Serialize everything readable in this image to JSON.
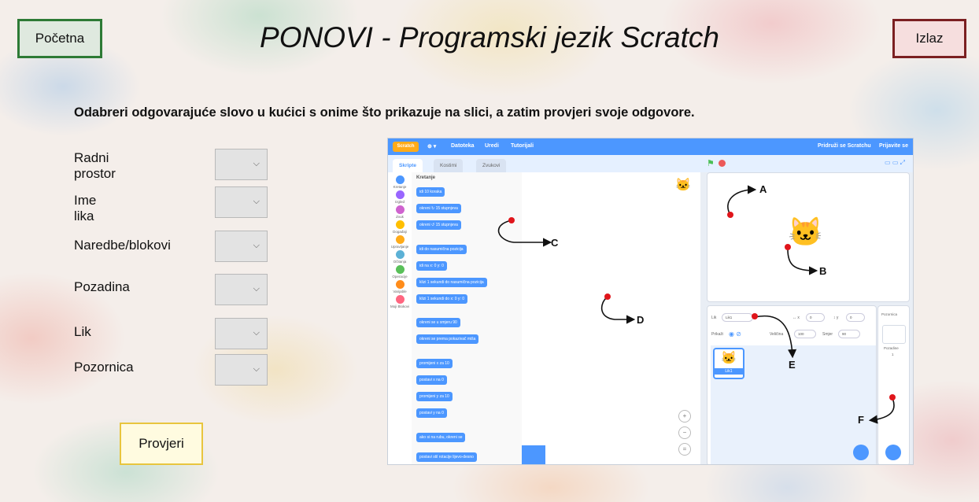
{
  "header": {
    "home_label": "Početna",
    "title": "PONOVI - Programski jezik Scratch",
    "exit_label": "Izlaz"
  },
  "instruction": "Odabreri odgovarajuće slovo u kućici s onime što prikazuje na slici, a zatim provjeri svoje odgovore.",
  "rows": [
    {
      "label": "Radni prostor",
      "value": ""
    },
    {
      "label": "Ime lika",
      "value": ""
    },
    {
      "label": "Naredbe/blokovi",
      "value": ""
    },
    {
      "label": "Pozadina",
      "value": ""
    },
    {
      "label": "Lik",
      "value": ""
    },
    {
      "label": "Pozornica",
      "value": ""
    }
  ],
  "check_label": "Provjeri",
  "scratch": {
    "logo": "Scratch",
    "menu": [
      "Datoteka",
      "Uredi",
      "Tutorijali"
    ],
    "menu_right": [
      "Pridruži se Scratchu",
      "Prijavite se"
    ],
    "tabs": [
      "Skripte",
      "Kostimi",
      "Zvukovi"
    ],
    "palette_title": "Kretanje",
    "categories": [
      {
        "name": "Kretanje",
        "color": "#4c97ff"
      },
      {
        "name": "Izgled",
        "color": "#9966ff"
      },
      {
        "name": "Zvuk",
        "color": "#cf63cf"
      },
      {
        "name": "Događaji",
        "color": "#ffbf00"
      },
      {
        "name": "Upravljanje",
        "color": "#ffab19"
      },
      {
        "name": "Očitanja",
        "color": "#5cb1d6"
      },
      {
        "name": "Operacije",
        "color": "#59c059"
      },
      {
        "name": "Varijable",
        "color": "#ff8c1a"
      },
      {
        "name": "Moji Blokovi",
        "color": "#ff6680"
      }
    ],
    "blocks": [
      "idi 10 koraka",
      "okreni ↻ 15 stupnjeva",
      "okreni ↺ 15 stupnjeva",
      "idi do nasumična pozicija",
      "idi na x: 0 y: 0",
      "klizi 1 sekundi do nasumična pozicija",
      "klizi 1 sekundi do x: 0 y: 0",
      "okreni se u smjeru 90",
      "okreni se prema pokazivač miša",
      "promijeni x za 10",
      "postavi x na 0",
      "promijeni y za 10",
      "postavi y na 0",
      "ako si na rubu, okreni se",
      "postavi stil rotacije lijevo-desno"
    ],
    "sprite": {
      "label": "Lik",
      "name": "Lik1",
      "x": "0",
      "y": "0",
      "show_label": "Prikaži",
      "size_label": "Veličina",
      "size": "100",
      "direction_label": "Smjer",
      "direction": "90",
      "thumb_label": "Lik1"
    },
    "stage_panel": {
      "title": "Pozornica",
      "backdrops_label": "Pozadine",
      "backdrops_count": "1"
    }
  },
  "callouts": [
    "A",
    "B",
    "C",
    "D",
    "E",
    "F"
  ]
}
